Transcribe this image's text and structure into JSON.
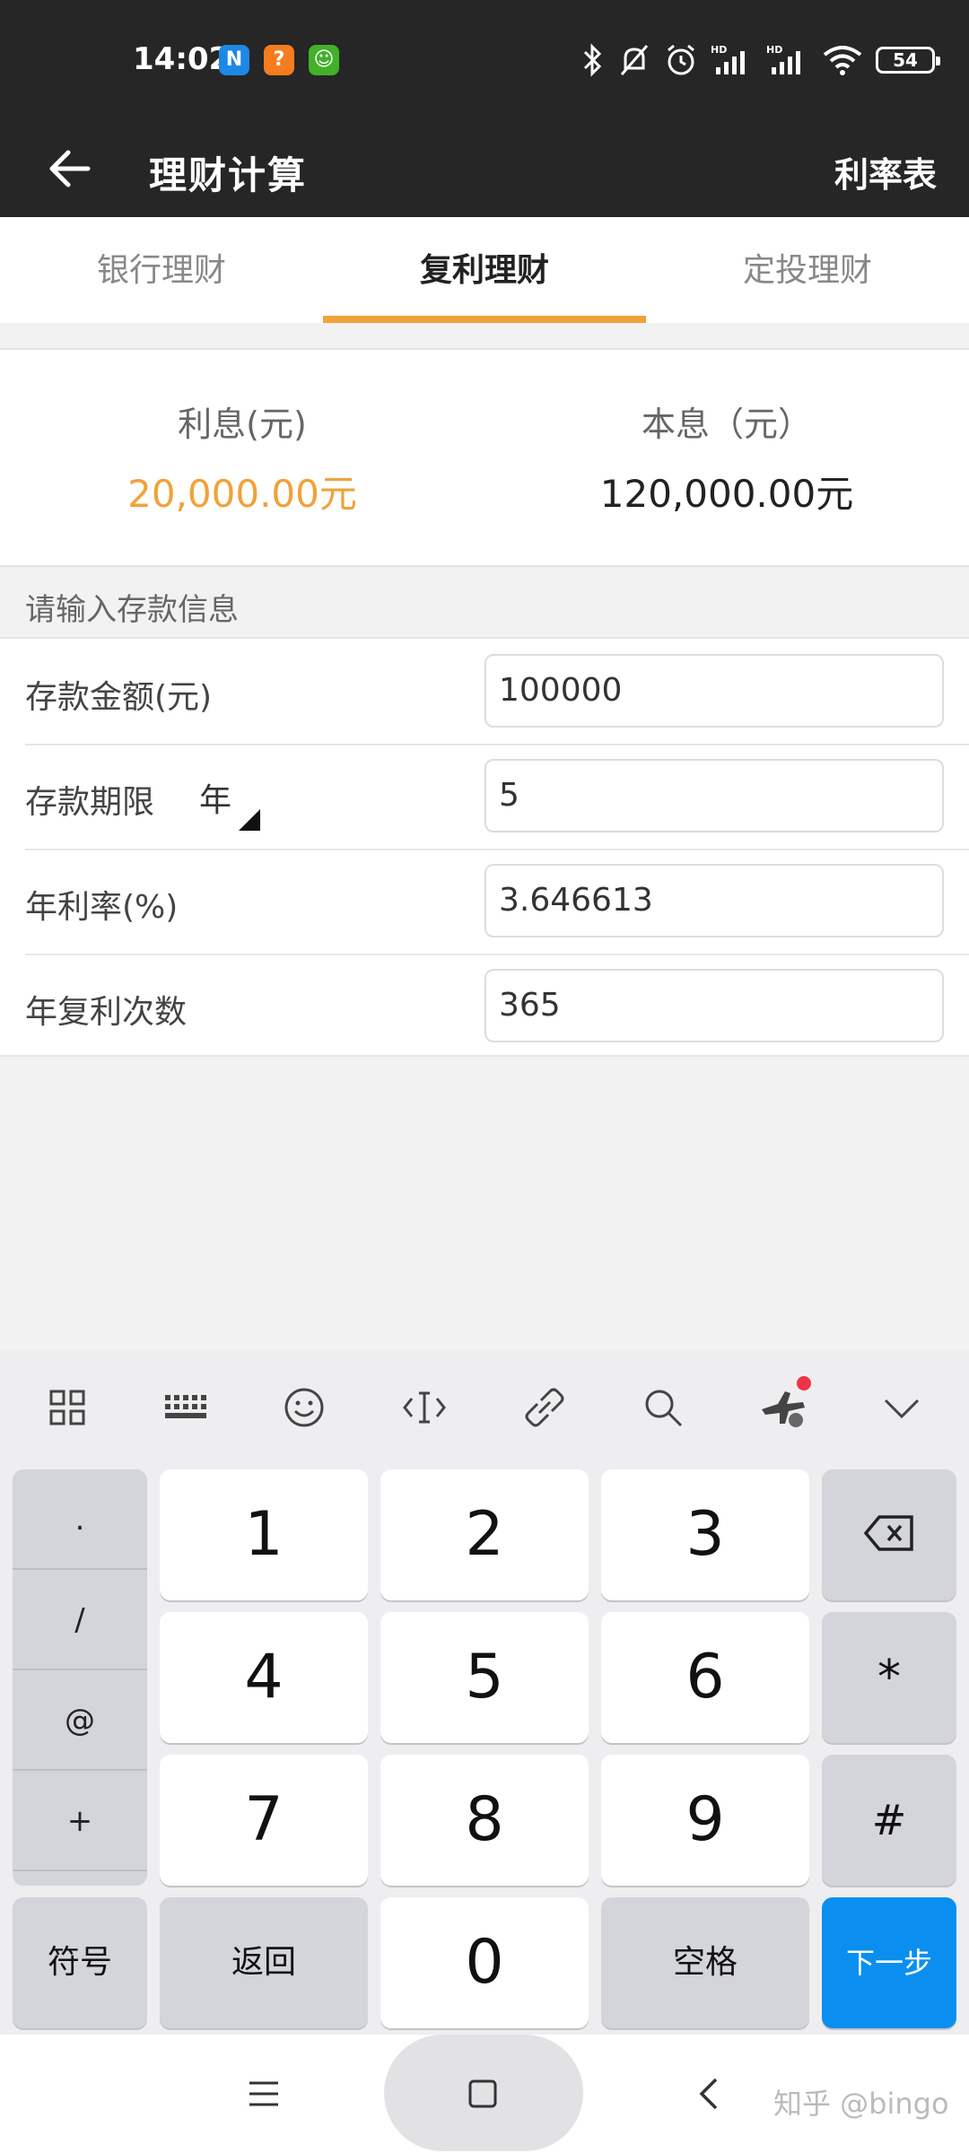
{
  "status_bar": {
    "time": "14:02",
    "app_icons": [
      {
        "name": "n-app-icon",
        "glyph": "N",
        "color": "#1e88e5"
      },
      {
        "name": "question-app-icon",
        "glyph": "?",
        "color": "#f57c1f"
      },
      {
        "name": "face-app-icon",
        "glyph": "☺",
        "color": "#43b02a"
      }
    ],
    "battery": "54"
  },
  "header": {
    "title": "理财计算",
    "right_link": "利率表"
  },
  "tabs": [
    {
      "label": "银行理财",
      "active": false
    },
    {
      "label": "复利理财",
      "active": true
    },
    {
      "label": "定投理财",
      "active": false
    }
  ],
  "summary": {
    "interest_label": "利息(元)",
    "interest_value": "20,000.00元",
    "total_label": "本息（元）",
    "total_value": "120,000.00元"
  },
  "form": {
    "section_title": "请输入存款信息",
    "rows": [
      {
        "label": "存款金额(元)",
        "value": "100000"
      },
      {
        "label": "存款期限",
        "unit": "年",
        "value": "5"
      },
      {
        "label": "年利率(%)",
        "value": "3.646613"
      },
      {
        "label": "年复利次数",
        "value": "365"
      }
    ]
  },
  "keyboard": {
    "symbols": [
      ".",
      "/",
      "@",
      "+"
    ],
    "digits": [
      "1",
      "2",
      "3",
      "4",
      "5",
      "6",
      "7",
      "8",
      "9",
      "0"
    ],
    "star": "*",
    "hash": "#",
    "symbol_key": "符号",
    "back_key": "返回",
    "space_key": "空格",
    "next_key": "下一步"
  },
  "watermark": "知乎 @bingo",
  "colors": {
    "accent_orange": "#f0a23a",
    "header_bg": "#262626",
    "next_blue": "#0a8ff0"
  }
}
